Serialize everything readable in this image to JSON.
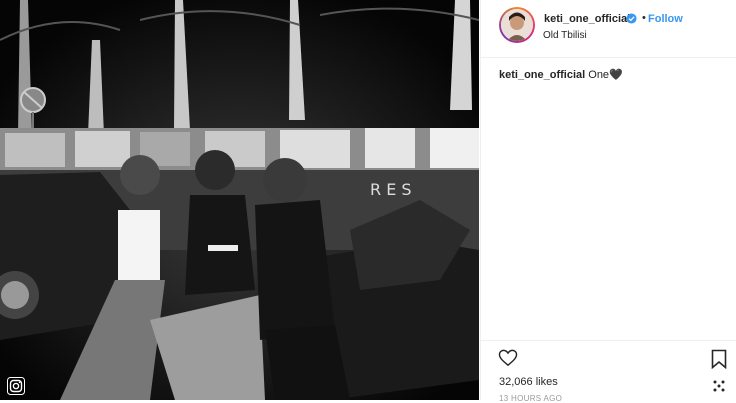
{
  "post": {
    "username": "keti_one_official",
    "follow_label": "Follow",
    "separator": "•",
    "location": "Old Tbilisi",
    "caption_user": "keti_one_official",
    "caption_text": " One🖤",
    "likes": "32,066 likes",
    "time": "13 HOURS AGO"
  },
  "icons": {
    "verified": "verified-badge-icon",
    "like": "heart-icon",
    "save": "bookmark-icon",
    "more": "grid-more-icon",
    "corner": "instagram-logo-icon"
  },
  "colors": {
    "accent": "#3897f0",
    "text": "#262626",
    "muted": "#999999",
    "border": "#efefef"
  }
}
